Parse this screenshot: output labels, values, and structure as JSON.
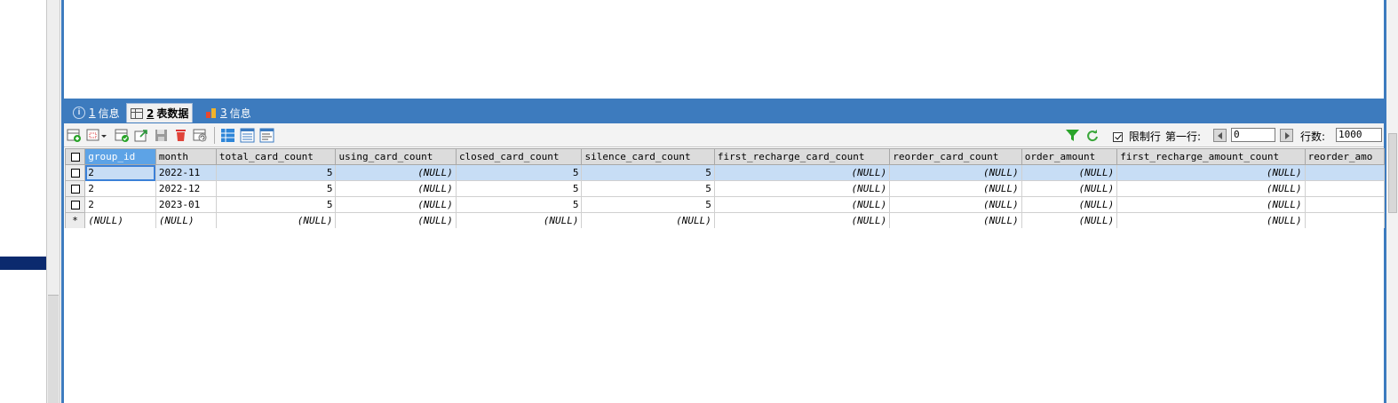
{
  "tabs": [
    {
      "num": "1",
      "label": "信息",
      "icon": "info-icon",
      "active": false
    },
    {
      "num": "2",
      "label": "表数据",
      "icon": "table-icon",
      "active": true
    },
    {
      "num": "3",
      "label": "信息",
      "icon": "chart-icon",
      "active": false
    }
  ],
  "toolbar": {
    "limit_rows_label": "限制行",
    "limit_rows_checked": true,
    "first_row_label": "第一行:",
    "first_row_value": "0",
    "row_count_label": "行数:",
    "row_count_value": "1000"
  },
  "table": {
    "columns": [
      "group_id",
      "month",
      "total_card_count",
      "using_card_count",
      "closed_card_count",
      "silence_card_count",
      "first_recharge_card_count",
      "reorder_card_count",
      "order_amount",
      "first_recharge_amount_count",
      "reorder_amo"
    ],
    "rows": [
      [
        "2",
        "2022-11",
        "5",
        "(NULL)",
        "5",
        "5",
        "(NULL)",
        "(NULL)",
        "(NULL)",
        "(NULL)",
        ""
      ],
      [
        "2",
        "2022-12",
        "5",
        "(NULL)",
        "5",
        "5",
        "(NULL)",
        "(NULL)",
        "(NULL)",
        "(NULL)",
        ""
      ],
      [
        "2",
        "2023-01",
        "5",
        "(NULL)",
        "5",
        "5",
        "(NULL)",
        "(NULL)",
        "(NULL)",
        "(NULL)",
        ""
      ]
    ],
    "new_row_marker": "*",
    "new_row": [
      "(NULL)",
      "(NULL)",
      "(NULL)",
      "(NULL)",
      "(NULL)",
      "(NULL)",
      "(NULL)",
      "(NULL)",
      "(NULL)",
      "(NULL)",
      ""
    ]
  },
  "colors": {
    "accent": "#3d7bbe",
    "header_selected": "#5da3e6",
    "row_selected": "#c7ddf5"
  }
}
